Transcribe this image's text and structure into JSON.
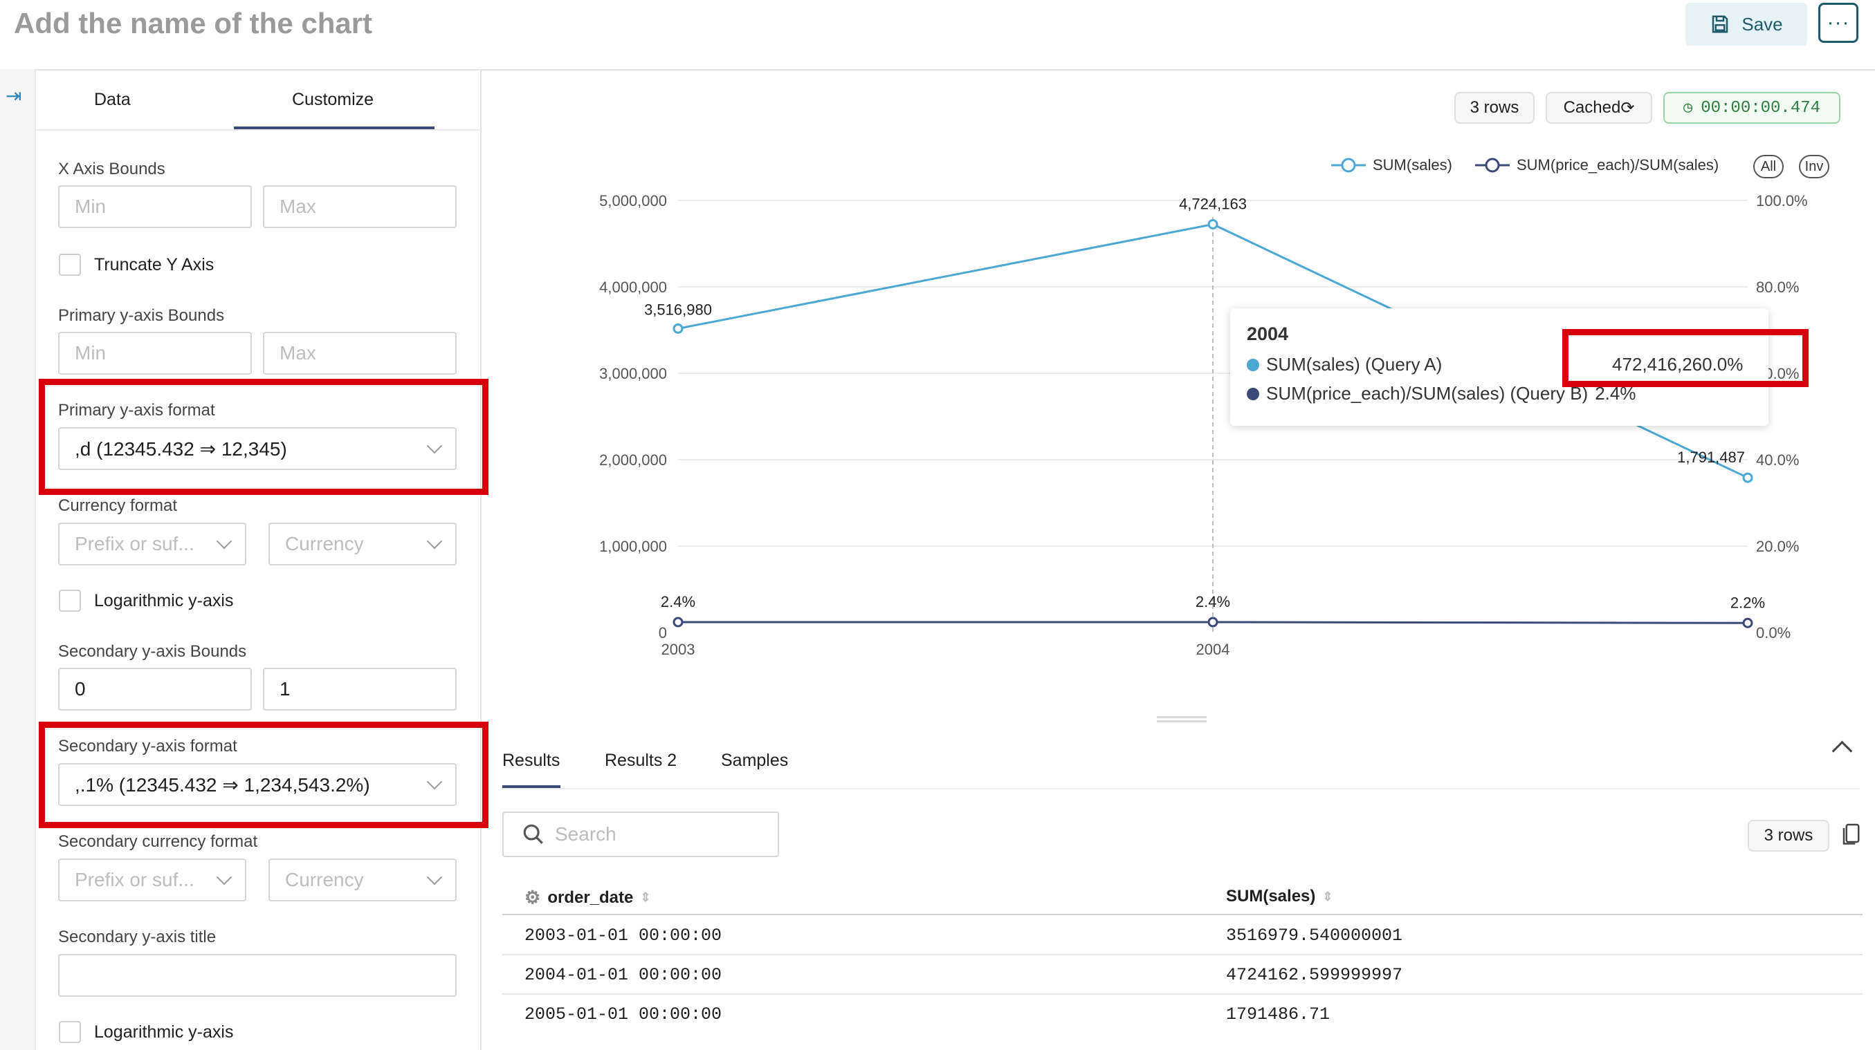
{
  "header": {
    "title": "Add the name of the chart",
    "save_label": "Save",
    "more_label": "···"
  },
  "panel": {
    "tabs": [
      "Data",
      "Customize"
    ],
    "active_tab": "Customize",
    "x_axis_bounds": {
      "label": "X Axis Bounds",
      "min_placeholder": "Min",
      "max_placeholder": "Max"
    },
    "truncate_y_axis": {
      "label": "Truncate Y Axis",
      "checked": false
    },
    "primary_y_bounds": {
      "label": "Primary y-axis Bounds",
      "min_placeholder": "Min",
      "max_placeholder": "Max"
    },
    "primary_y_format": {
      "label": "Primary y-axis format",
      "value": ",d (12345.432 ⇒ 12,345)"
    },
    "currency_format": {
      "label": "Currency format",
      "prefix_placeholder": "Prefix or suf...",
      "currency_placeholder": "Currency"
    },
    "log_y_axis": {
      "label": "Logarithmic y-axis",
      "checked": false
    },
    "secondary_y_bounds": {
      "label": "Secondary y-axis Bounds",
      "min": "0",
      "max": "1"
    },
    "secondary_y_format": {
      "label": "Secondary y-axis format",
      "value": ",.1% (12345.432 ⇒ 1,234,543.2%)"
    },
    "secondary_currency_format": {
      "label": "Secondary currency format",
      "prefix_placeholder": "Prefix or suf...",
      "currency_placeholder": "Currency"
    },
    "secondary_y_title": {
      "label": "Secondary y-axis title",
      "value": ""
    },
    "secondary_log_y_axis": {
      "label": "Logarithmic y-axis",
      "checked": false
    }
  },
  "chart_header": {
    "rows": "3 rows",
    "cached": "Cached",
    "timer": "00:00:00.474"
  },
  "legend": {
    "all_label": "All",
    "inv_label": "Inv"
  },
  "chart_data": {
    "type": "line",
    "x": [
      "2003",
      "2004",
      "2005"
    ],
    "x_tick_labels": [
      "2003",
      "2004"
    ],
    "series": [
      {
        "name": "SUM(sales)",
        "axis": "primary",
        "color": "#4aa8d3",
        "values": [
          3516980,
          4724163,
          1791487
        ],
        "labels": [
          "3,516,980",
          "4,724,163",
          "1,791,487"
        ]
      },
      {
        "name": "SUM(price_each)/SUM(sales)",
        "axis": "secondary",
        "color": "#3b4a78",
        "values": [
          0.024,
          0.024,
          0.022
        ],
        "labels": [
          "2.4%",
          "2.4%",
          "2.2%"
        ]
      }
    ],
    "primary_ylim": [
      0,
      5000000
    ],
    "primary_ticks": [
      "5,000,000",
      "4,000,000",
      "3,000,000",
      "2,000,000",
      "1,000,000",
      "0"
    ],
    "secondary_ylim": [
      0,
      1
    ],
    "secondary_ticks": [
      "100.0%",
      "80.0%",
      "60.0%",
      "40.0%",
      "20.0%",
      "0.0%"
    ],
    "grid": true,
    "legend_position": "top-right"
  },
  "tooltip": {
    "title": "2004",
    "rows": [
      {
        "label": "SUM(sales) (Query A)",
        "value": "472,416,260.0%",
        "color": "#4aa8d3"
      },
      {
        "label": "SUM(price_each)/SUM(sales) (Query B)",
        "value": "2.4%",
        "color": "#3b4a78"
      }
    ]
  },
  "results": {
    "tabs": [
      "Results",
      "Results 2",
      "Samples"
    ],
    "search_placeholder": "Search",
    "rows_badge": "3 rows",
    "columns": [
      "order_date",
      "SUM(sales)"
    ],
    "rows": [
      [
        "2003-01-01 00:00:00",
        "3516979.540000001"
      ],
      [
        "2004-01-01 00:00:00",
        "4724162.599999997"
      ],
      [
        "2005-01-01 00:00:00",
        "1791486.71"
      ]
    ]
  }
}
